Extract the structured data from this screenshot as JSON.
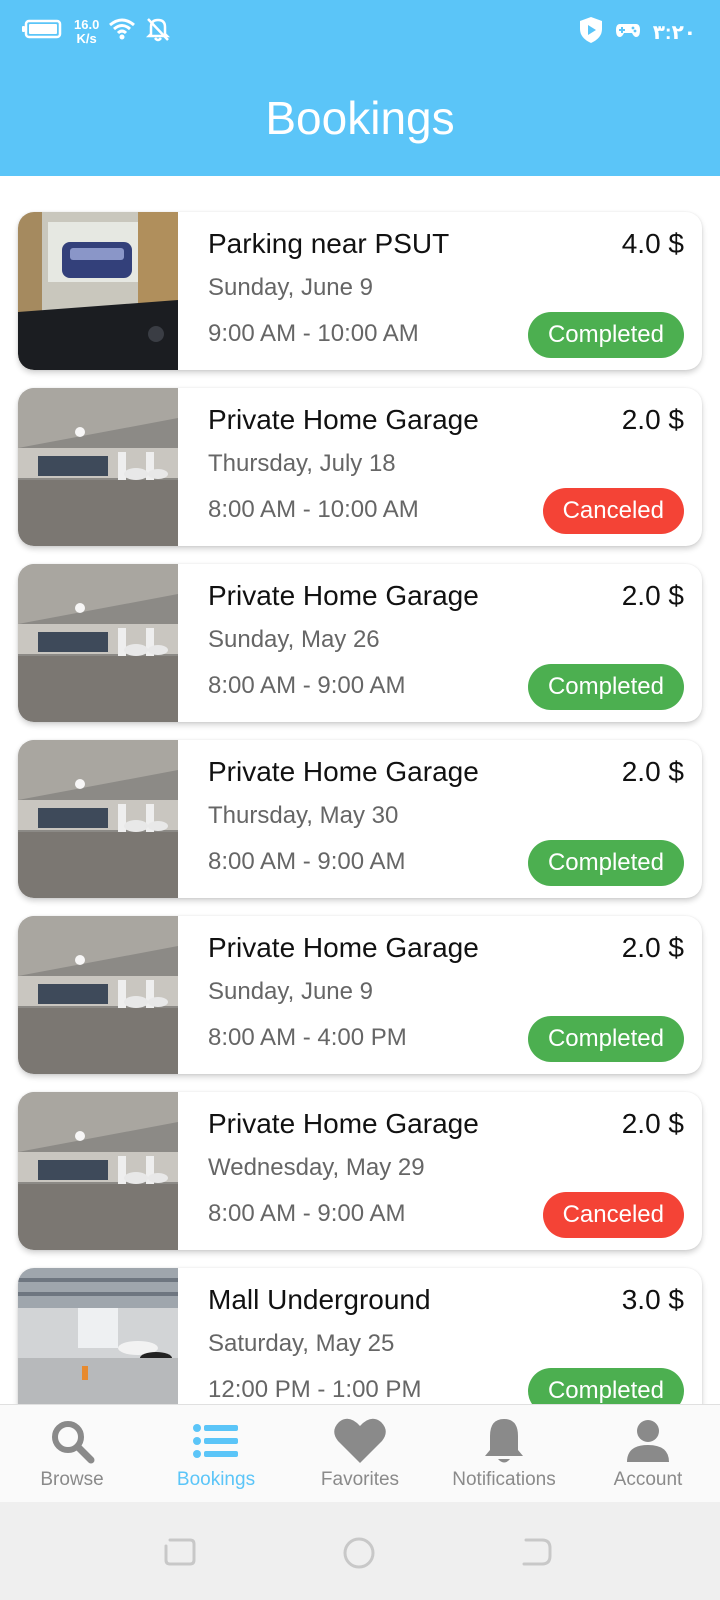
{
  "status_bar": {
    "speed_value": "16.0",
    "speed_unit": "K/s",
    "time": "٣:٢٠"
  },
  "header": {
    "title": "Bookings"
  },
  "bookings": [
    {
      "name": "Parking near PSUT",
      "price": "4.0 $",
      "date": "Sunday, June 9",
      "time": "9:00 AM - 10:00 AM",
      "status": "Completed"
    },
    {
      "name": "Private Home Garage",
      "price": "2.0 $",
      "date": "Thursday, July 18",
      "time": "8:00 AM - 10:00 AM",
      "status": "Canceled"
    },
    {
      "name": "Private Home Garage",
      "price": "2.0 $",
      "date": "Sunday, May 26",
      "time": "8:00 AM - 9:00 AM",
      "status": "Completed"
    },
    {
      "name": "Private Home Garage",
      "price": "2.0 $",
      "date": "Thursday, May 30",
      "time": "8:00 AM - 9:00 AM",
      "status": "Completed"
    },
    {
      "name": "Private Home Garage",
      "price": "2.0 $",
      "date": "Sunday, June 9",
      "time": "8:00 AM - 4:00 PM",
      "status": "Completed"
    },
    {
      "name": "Private Home Garage",
      "price": "2.0 $",
      "date": "Wednesday, May 29",
      "time": "8:00 AM - 9:00 AM",
      "status": "Canceled"
    },
    {
      "name": "Mall Underground",
      "price": "3.0 $",
      "date": "Saturday, May 25",
      "time": "12:00 PM - 1:00 PM",
      "status": "Completed"
    }
  ],
  "colors": {
    "header": "#5bc5f8",
    "completed": "#4caf50",
    "canceled": "#f44336",
    "nav_active": "#5bc5f8",
    "nav_inactive": "#8a8a8a"
  },
  "nav": {
    "browse": "Browse",
    "bookings": "Bookings",
    "favorites": "Favorites",
    "notifications": "Notifications",
    "account": "Account"
  }
}
